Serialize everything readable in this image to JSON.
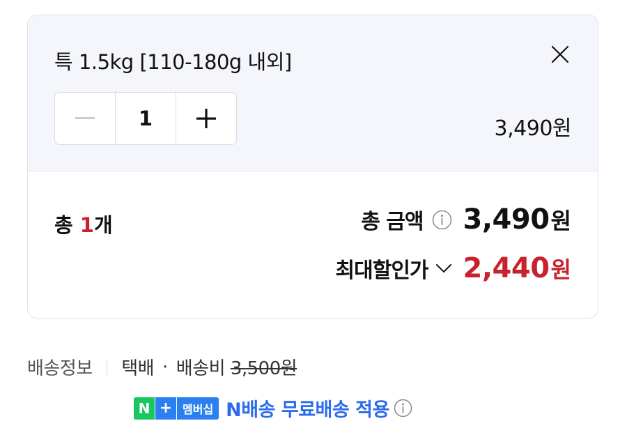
{
  "option": {
    "title": "특 1.5kg [110-180g 내외]",
    "quantity": "1",
    "price": "3,490원"
  },
  "summary": {
    "count_prefix": "총 ",
    "count": "1",
    "count_suffix": "개",
    "total_label": "총 금액",
    "total_amount": "3,490",
    "discount_label": "최대할인가",
    "discount_amount": "2,440",
    "currency": "원"
  },
  "shipping": {
    "label": "배송정보",
    "method": "택배",
    "dot": "·",
    "fee_label": "배송비",
    "fee": "3,500원"
  },
  "membership": {
    "badge_n": "N",
    "badge_plus": "+",
    "badge_text": "멤버십",
    "text": "N배송 무료배송 적용"
  },
  "colors": {
    "accent_red": "#c8232c",
    "link_blue": "#2c6bed",
    "naver_green": "#19c75e",
    "badge_blue": "#2c7ff0",
    "option_bg": "#f4f6fc"
  },
  "icons": [
    "close-icon",
    "minus-icon",
    "plus-icon",
    "info-icon",
    "chevron-down-icon"
  ]
}
